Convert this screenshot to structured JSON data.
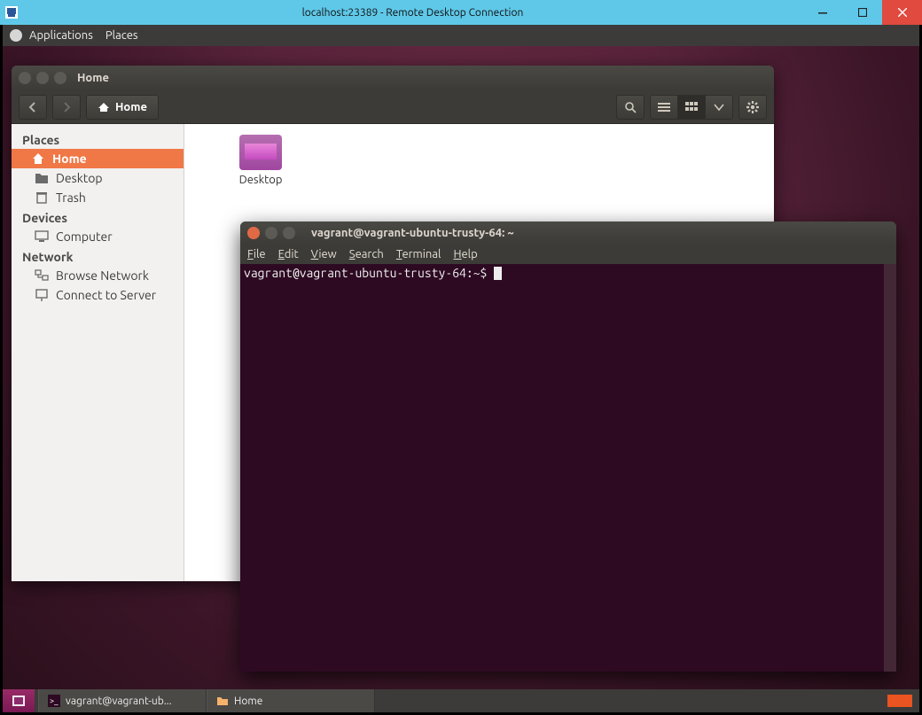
{
  "rdp": {
    "title": "localhost:23389 - Remote Desktop Connection"
  },
  "gnome_top": {
    "apps": "Applications",
    "places": "Places"
  },
  "nautilus": {
    "title": "Home",
    "path_button": "Home",
    "sidebar": {
      "places_header": "Places",
      "home": "Home",
      "desktop": "Desktop",
      "trash": "Trash",
      "devices_header": "Devices",
      "computer": "Computer",
      "network_header": "Network",
      "browse_network": "Browse Network",
      "connect_server": "Connect to Server"
    },
    "file_desktop": "Desktop"
  },
  "terminal": {
    "title": "vagrant@vagrant-ubuntu-trusty-64: ~",
    "menu": {
      "file": "File",
      "edit": "Edit",
      "view": "View",
      "search": "Search",
      "terminal": "Terminal",
      "help": "Help"
    },
    "prompt": "vagrant@vagrant-ubuntu-trusty-64:~$ "
  },
  "taskbar": {
    "term": "vagrant@vagrant-ub...",
    "files": "Home"
  }
}
